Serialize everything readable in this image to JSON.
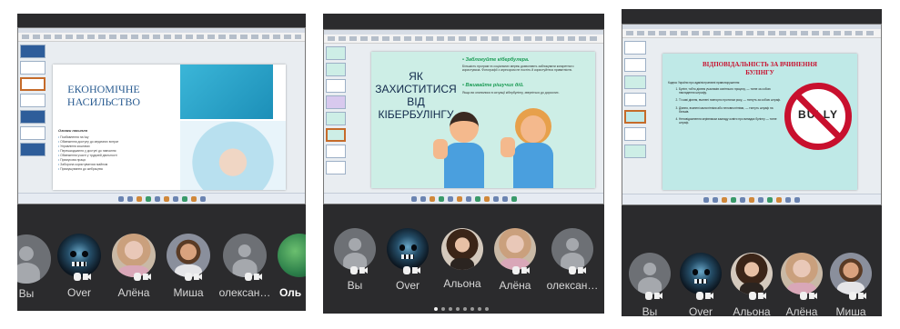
{
  "phones": [
    {
      "slide": {
        "title": "ЕКОНОМІЧНЕ НАСИЛЬСТВО",
        "subtitle": "Ознаки насилля",
        "bullets": [
          "Позбавлення на їжу",
          "Обмеження доступу до медичних витрат",
          "Управління коштами",
          "Перешкоджання у доступі до навчання",
          "Обмеження участі у трудовій діяльності",
          "Примусова праця",
          "Заборона користуватися майном",
          "Примушування до жебрацтва"
        ]
      },
      "participants": [
        {
          "name": "Вы",
          "avatar": "default-avatar"
        },
        {
          "name": "Over",
          "avatar": "skull-avatar"
        },
        {
          "name": "Алёна",
          "avatar": "photo-avatar"
        },
        {
          "name": "Миша",
          "avatar": "photo-avatar"
        },
        {
          "name": "олексан…",
          "avatar": "default-avatar"
        },
        {
          "name": "Оль",
          "avatar": "photo-avatar"
        }
      ]
    },
    {
      "slide": {
        "title": "ЯК ЗАХИСТИТИСЯ ВІД КІБЕРБУЛІНГУ",
        "heading1": "• Заблокуйте кібербулера.",
        "text1": "Більшість програм та соціальних мереж дозволяють заблокувати конкретного користувача. Фотографії з агресором не постіть й користуйтеся приватністю.",
        "heading2": "• Вживайте рішучих дій.",
        "text2": "Якщо ви опинилися в ситуації кібербулінгу, зверніться до дорослих."
      },
      "participants": [
        {
          "name": "Вы",
          "avatar": "default-avatar"
        },
        {
          "name": "Over",
          "avatar": "skull-avatar"
        },
        {
          "name": "Альона",
          "avatar": "photo-avatar"
        },
        {
          "name": "Алёна",
          "avatar": "photo-avatar"
        },
        {
          "name": "олексан…",
          "avatar": "default-avatar"
        }
      ],
      "pager": {
        "count": 8,
        "active": 0
      }
    },
    {
      "slide": {
        "title": "ВІДПОВІДАЛЬНІСТЬ ЗА ВЧИНЕННЯ БУЛІНГУ",
        "intro": "Кодекс України про адміністративні правопорушення",
        "items": [
          "Булінг, тобто діяння учасників освітнього процесу, — тягне за собою накладення штрафу.",
          "Ті самі діяння, вчинені повторно протягом року, — тягнуть за собою штраф.",
          "Діяння, вчинені малолітніми або неповнолітніми, — тягнуть штраф на батьків.",
          "Неповідомлення керівником закладу освіти про випадки булінгу — тягне штраф."
        ],
        "stamp": "BULLY"
      },
      "participants": [
        {
          "name": "Вы",
          "avatar": "default-avatar"
        },
        {
          "name": "Over",
          "avatar": "skull-avatar"
        },
        {
          "name": "Альона",
          "avatar": "photo-avatar"
        },
        {
          "name": "Алёна",
          "avatar": "photo-avatar"
        },
        {
          "name": "Миша",
          "avatar": "photo-avatar"
        }
      ]
    }
  ],
  "colors": {
    "call_bg": "#2b2b2d",
    "slide1_accent": "#2d6fa6",
    "slide2_bg": "#cdeee6",
    "slide3_bg": "#bfe9e7",
    "stamp_red": "#c8102e"
  }
}
